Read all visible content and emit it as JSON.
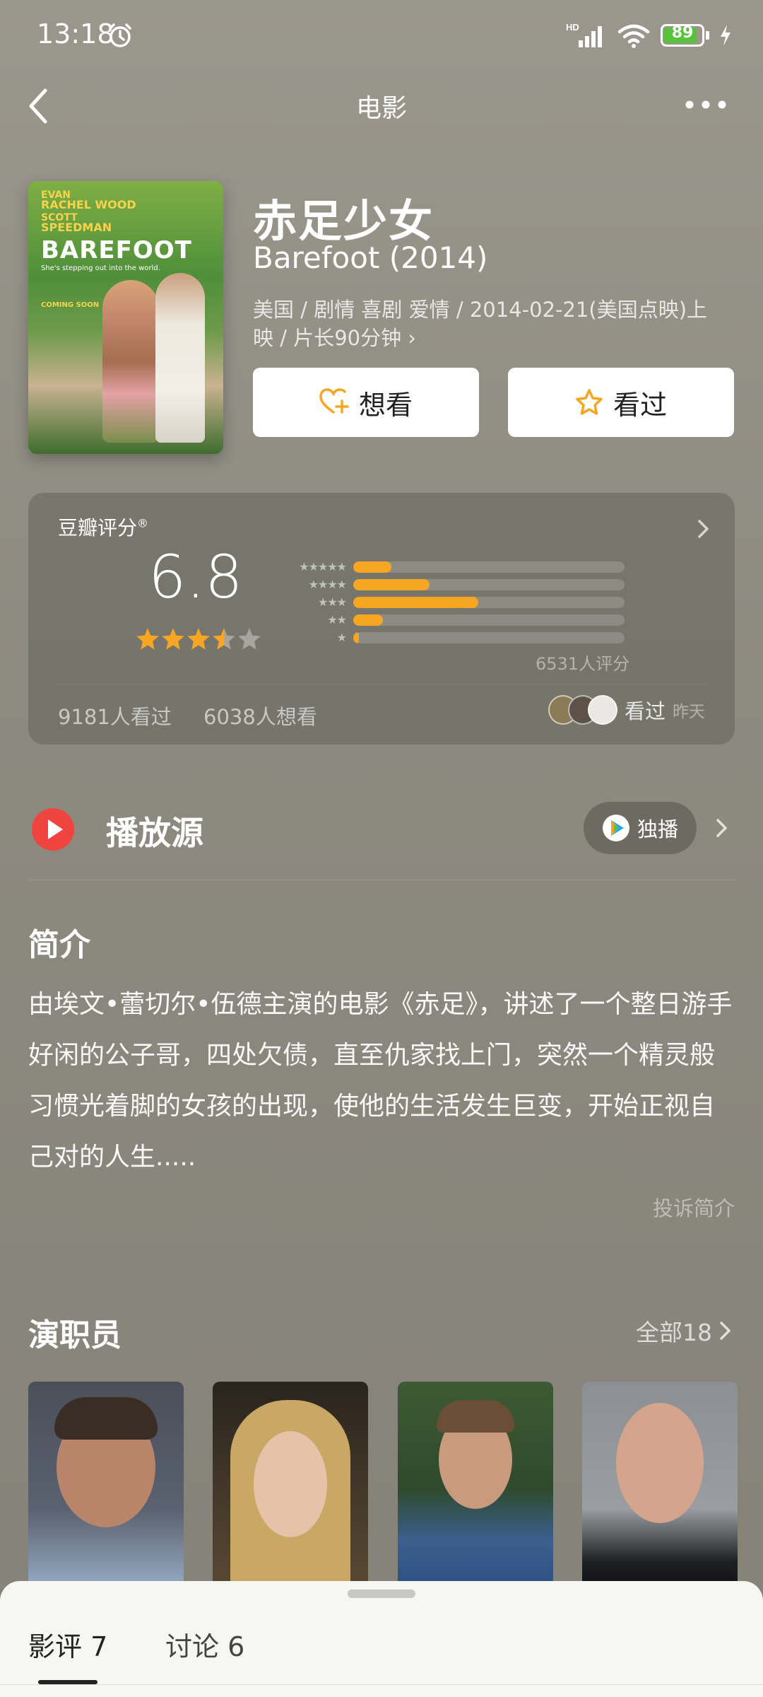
{
  "status_bar": {
    "time": "13:18",
    "battery": "89",
    "battery_level": 0.89,
    "network": "HD"
  },
  "nav": {
    "title": "电影"
  },
  "movie": {
    "title_cn": "赤足少女",
    "title_en": "Barefoot (2014)",
    "meta": "美国 / 剧情 喜剧 爱情 / 2014-02-21(美国点映)上映 / 片长90分钟 ›",
    "poster": {
      "credit1": "EVAN",
      "credit2": "RACHEL WOOD",
      "credit3": "SCOTT",
      "credit4": "SPEEDMAN",
      "title": "BAREFOOT",
      "tagline": "She's stepping out into the world.",
      "coming": "COMING SOON"
    }
  },
  "actions": {
    "want": "想看",
    "seen": "看过"
  },
  "rating": {
    "label": "豆瓣评分",
    "registered": "®",
    "score": "6.8",
    "stars_value": 3.5,
    "distribution": [
      {
        "stars": "★★★★★",
        "fraction": 0.14
      },
      {
        "stars": "★★★★",
        "fraction": 0.28
      },
      {
        "stars": "★★★",
        "fraction": 0.46
      },
      {
        "stars": "★★",
        "fraction": 0.11
      },
      {
        "stars": "★",
        "fraction": 0.02
      }
    ],
    "count": "6531人评分",
    "seen_count": "9181人看过",
    "want_count": "6038人想看",
    "friends_label": "看过",
    "friends_time": "昨天"
  },
  "play": {
    "title": "播放源",
    "source": "独播"
  },
  "intro": {
    "heading": "简介",
    "text": "由埃文•蕾切尔•伍德主演的电影《赤足》，讲述了一个整日游手好闲的公子哥，四处欠债，直至仇家找上门，突然一个精灵般习惯光着脚的女孩的出现，使他的生活发生巨变，开始正视自己对的人生.....",
    "report": "投诉简介"
  },
  "cast": {
    "heading": "演职员",
    "all": "全部18"
  },
  "bottom_tabs": [
    {
      "label": "影评 7"
    },
    {
      "label": "讨论 6"
    }
  ],
  "colors": {
    "accent": "#f6a623",
    "background": "#8e8b80",
    "play_red": "#f0453f"
  }
}
